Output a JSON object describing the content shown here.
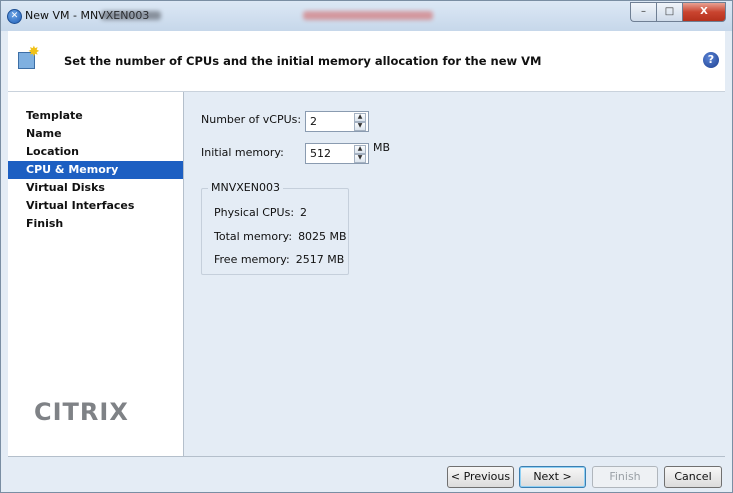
{
  "window": {
    "title": "New VM - MNVXEN003",
    "controls": {
      "minimize": "–",
      "maximize": "□",
      "close": "X"
    }
  },
  "header": {
    "title": "Set the number of CPUs and the initial memory allocation for the new VM",
    "help": "?"
  },
  "sidebar": {
    "items": [
      {
        "label": "Template",
        "active": false
      },
      {
        "label": "Name",
        "active": false
      },
      {
        "label": "Location",
        "active": false
      },
      {
        "label": "CPU & Memory",
        "active": true
      },
      {
        "label": "Virtual Disks",
        "active": false
      },
      {
        "label": "Virtual Interfaces",
        "active": false
      },
      {
        "label": "Finish",
        "active": false
      }
    ],
    "logo": "CITRIX"
  },
  "form": {
    "vcpus_label": "Number of vCPUs:",
    "vcpus_value": "2",
    "memory_label": "Initial memory:",
    "memory_value": "512",
    "memory_unit": "MB"
  },
  "host_info": {
    "title": "MNVXEN003",
    "rows": [
      {
        "label": "Physical CPUs:",
        "value": "2"
      },
      {
        "label": "Total memory:",
        "value": "8025 MB"
      },
      {
        "label": "Free memory:",
        "value": "2517 MB"
      }
    ]
  },
  "buttons": {
    "previous": "< Previous",
    "next": "Next >",
    "finish": "Finish",
    "cancel": "Cancel"
  },
  "colors": {
    "accent": "#1d5fc2",
    "panel": "#e4ecf5"
  },
  "icons": {
    "app": "xen-app-icon",
    "wizard": "new-vm-icon",
    "help": "help-icon"
  }
}
